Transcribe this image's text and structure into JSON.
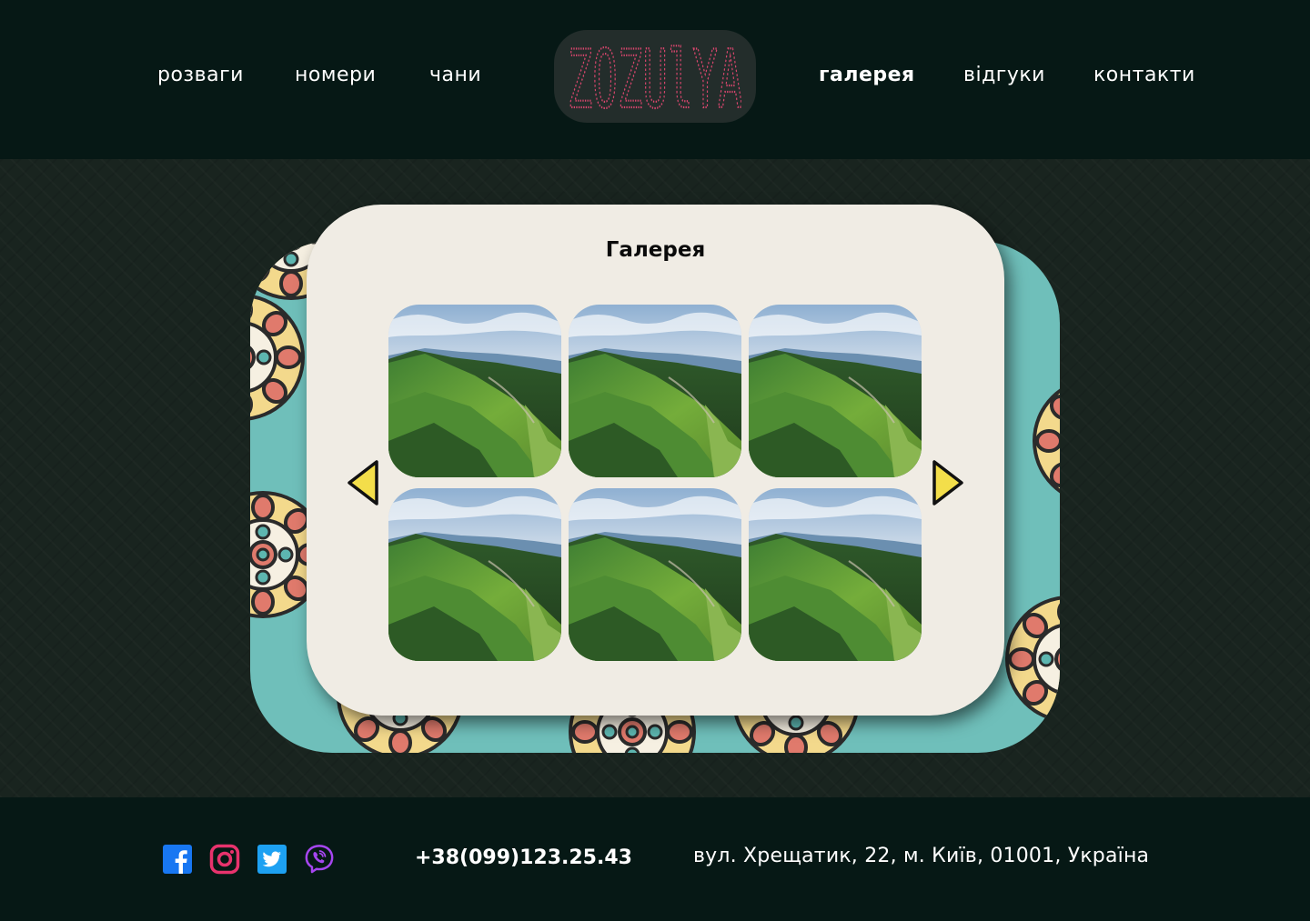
{
  "nav": {
    "left": [
      {
        "label": "розваги"
      },
      {
        "label": "номери"
      },
      {
        "label": "чани"
      }
    ],
    "right": [
      {
        "label": "галерея",
        "active": true
      },
      {
        "label": "відгуки"
      },
      {
        "label": "контакти"
      }
    ],
    "logo_text": "ZOZUlYA"
  },
  "gallery": {
    "title": "Галерея",
    "photo_subject": "mountain-ridge-landscape",
    "photo_count": 6,
    "prev_icon": "triangle-left-icon",
    "next_icon": "triangle-right-icon"
  },
  "footer": {
    "socials": [
      {
        "name": "facebook-icon",
        "color": "#1877f2"
      },
      {
        "name": "instagram-icon",
        "color": "#e8336d"
      },
      {
        "name": "twitter-icon",
        "color": "#1da1f2"
      },
      {
        "name": "viber-icon",
        "color": "#a646f0"
      }
    ],
    "phone": "+38(099)123.25.43",
    "address": "вул. Хрещатик, 22, м. Київ, 01001, Україна"
  },
  "colors": {
    "header_bg": "#061815",
    "main_bg": "#19241f",
    "teal": "#6fbfba",
    "card": "#f0ece4",
    "arrow_fill": "#f3de4a",
    "logo_text": "#d9466e"
  }
}
